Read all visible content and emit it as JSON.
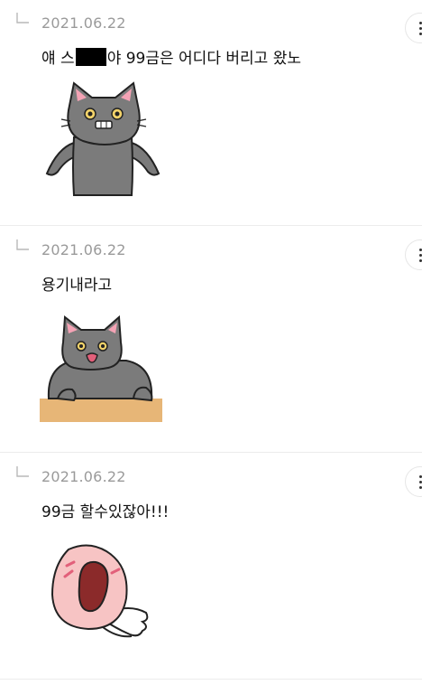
{
  "comments": [
    {
      "date": "2021.06.22",
      "text_before": "얘 ",
      "text_visible_fragment": "스",
      "text_after": "야 99금은 어디다 버리고 왔노",
      "sticker_icon": "crying-cat-sticker"
    },
    {
      "date": "2021.06.22",
      "text": "용기내라고",
      "sticker_icon": "teary-cat-at-desk-sticker"
    },
    {
      "date": "2021.06.22",
      "text": "99금 할수있잖아!!!",
      "sticker_icon": "pink-peach-shouting-sticker"
    }
  ],
  "colors": {
    "date": "#9a9a9a",
    "text": "#111111",
    "divider": "#ececec",
    "cat": "#7b7b7b",
    "desk": "#e7b677",
    "peach": "#f7c4c4"
  }
}
